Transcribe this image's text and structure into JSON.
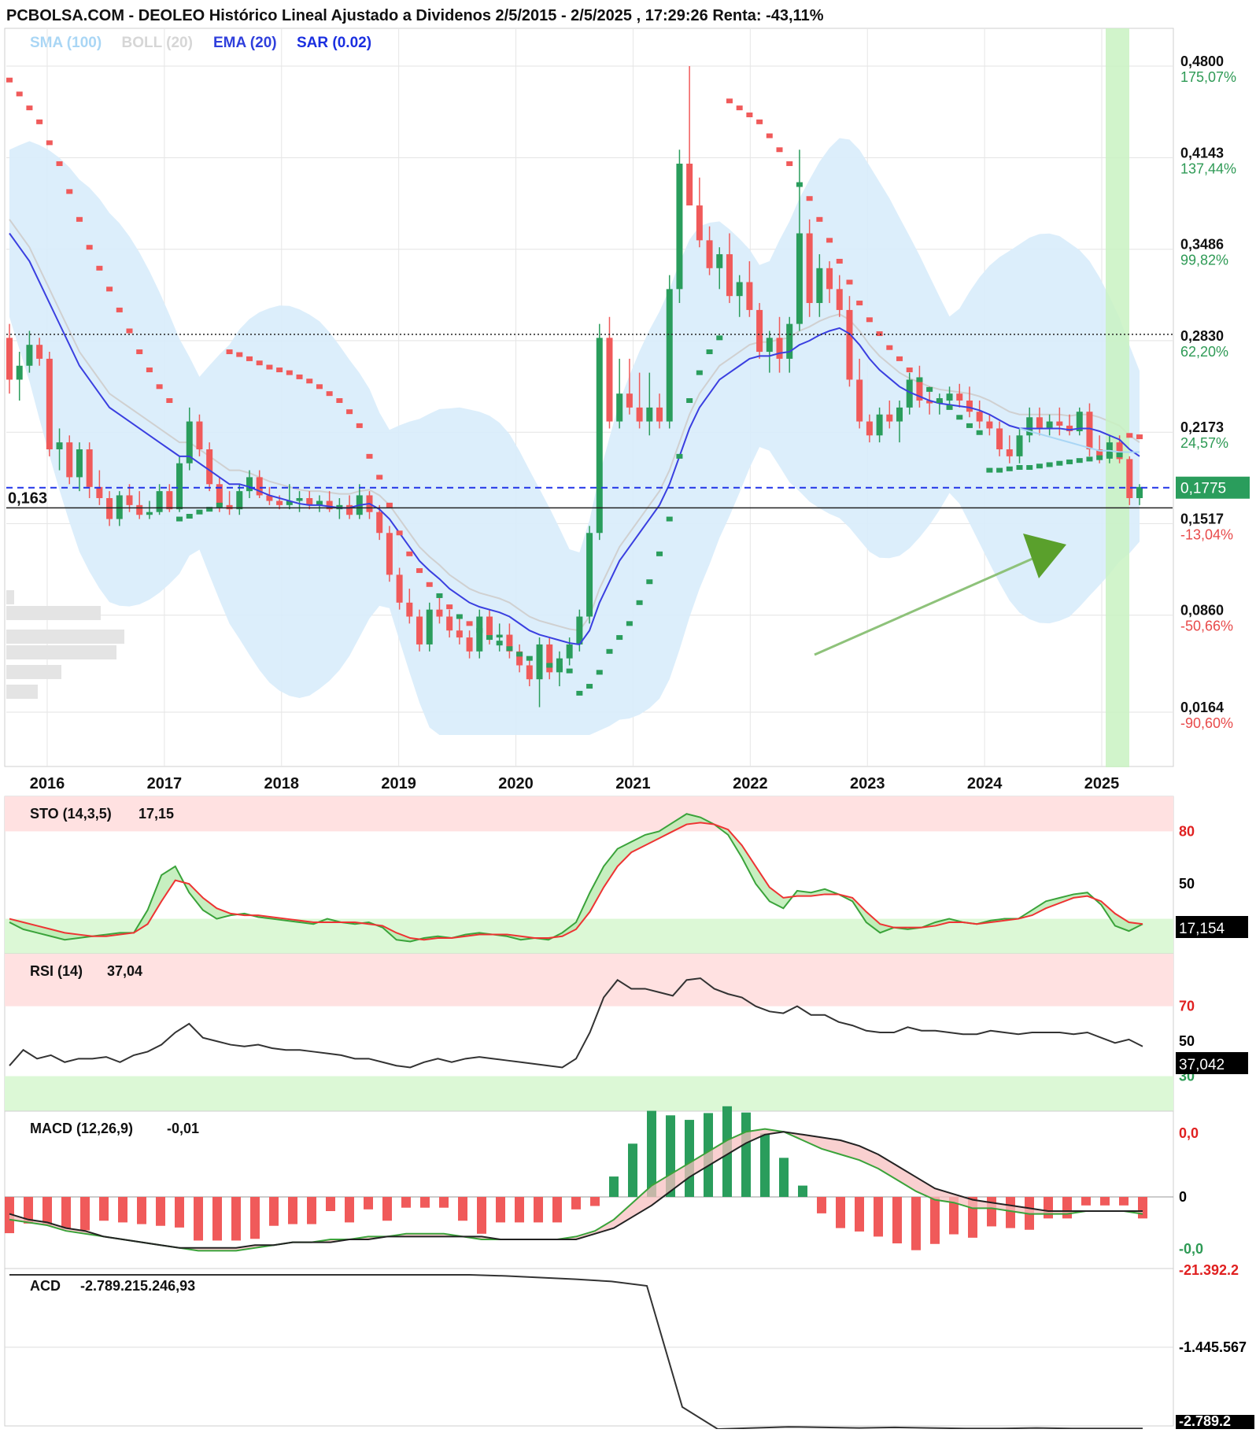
{
  "header": {
    "title": "PCBOLSA.COM - DEOLEO Histórico Lineal Ajustado a Dividenos 2/5/2015 - 2/5/2025 , 17:29:26 Renta: -43,11%"
  },
  "legend": [
    {
      "label": "SMA (100)",
      "color": "#a9d6f5"
    },
    {
      "label": "BOLL (20)",
      "color": "#d6d6d6"
    },
    {
      "label": "EMA (20)",
      "color": "#2f3fdc"
    },
    {
      "label": "SAR (0.02)",
      "color": "#1a2fe0"
    }
  ],
  "price_axis": {
    "ticks": [
      {
        "value": 0.48,
        "label": "0,4800",
        "pct": "175,07%",
        "pct_color": "#2e9a55"
      },
      {
        "value": 0.4143,
        "label": "0,4143",
        "pct": "137,44%",
        "pct_color": "#2e9a55"
      },
      {
        "value": 0.3486,
        "label": "0,3486",
        "pct": "99,82%",
        "pct_color": "#2e9a55"
      },
      {
        "value": 0.283,
        "label": "0,2830",
        "pct": "62,20%",
        "pct_color": "#2e9a55"
      },
      {
        "value": 0.2173,
        "label": "0,2173",
        "pct": "24,57%",
        "pct_color": "#2e9a55"
      },
      {
        "value": 0.1517,
        "label": "0,1517",
        "pct": "-13,04%",
        "pct_color": "#e84a4a"
      },
      {
        "value": 0.086,
        "label": "0,0860",
        "pct": "-50,66%",
        "pct_color": "#e84a4a"
      },
      {
        "value": 0.0164,
        "label": "0,0164",
        "pct": "-90,60%",
        "pct_color": "#e84a4a"
      }
    ],
    "current_price_label": "0,1775",
    "current_price": 0.1775,
    "reference_price_label": "0,163",
    "reference_price": 0.163,
    "dotted_line_price": 0.2875
  },
  "x_axis": {
    "years": [
      "2016",
      "2017",
      "2018",
      "2019",
      "2020",
      "2021",
      "2022",
      "2023",
      "2024",
      "2025"
    ]
  },
  "colors": {
    "up": "#2a9d5c",
    "down": "#f05a5a",
    "boll_fill": "#d8ecfb",
    "ema": "#3a3fe0",
    "sma": "#a9d6f5",
    "boll_mid": "#d0d0d0",
    "highlight": "#c9f2c2",
    "arrow": "#5aa02c"
  },
  "panels": {
    "sto": {
      "label": "STO (14,3,5)",
      "value": "17,15",
      "box": "17,154",
      "ticks": [
        {
          "v": 80,
          "t": "80",
          "c": "#e02020"
        },
        {
          "v": 50,
          "t": "50",
          "c": "#000000"
        }
      ]
    },
    "rsi": {
      "label": "RSI (14)",
      "value": "37,04",
      "box": "37,042",
      "ticks": [
        {
          "v": 70,
          "t": "70",
          "c": "#e02020"
        },
        {
          "v": 50,
          "t": "50",
          "c": "#000000"
        },
        {
          "v": 30,
          "t": "30",
          "c": "#2e9a55"
        }
      ]
    },
    "macd": {
      "label": "MACD (12,26,9)",
      "value": "-0,01",
      "ticks": [
        {
          "t": "0,0",
          "c": "#e02020"
        },
        {
          "t": "0",
          "c": "#000000"
        },
        {
          "t": "-0,0",
          "c": "#2e9a55"
        }
      ]
    },
    "acd": {
      "label": "ACD",
      "value": "-2.789.215.246,93",
      "ticks": [
        {
          "t": "-21.392.2",
          "c": "#e02020"
        },
        {
          "t": "-1.445.567",
          "c": "#000000"
        },
        {
          "t": "-2.789.2",
          "c": "#ffffff"
        }
      ]
    }
  },
  "chart_data": {
    "type": "candlestick",
    "title": "PCBOLSA.COM - DEOLEO Histórico Lineal Ajustado a Dividenos 2/5/2015 - 2/5/2025 , 17:29:26 Renta: -43,11%",
    "ylim": [
      0.0,
      0.51
    ],
    "ohlc_monthly": [
      [
        0.285,
        0.295,
        0.245,
        0.255
      ],
      [
        0.255,
        0.275,
        0.24,
        0.265
      ],
      [
        0.265,
        0.29,
        0.26,
        0.28
      ],
      [
        0.28,
        0.285,
        0.265,
        0.27
      ],
      [
        0.27,
        0.275,
        0.2,
        0.205
      ],
      [
        0.205,
        0.22,
        0.19,
        0.21
      ],
      [
        0.21,
        0.215,
        0.18,
        0.185
      ],
      [
        0.185,
        0.21,
        0.175,
        0.205
      ],
      [
        0.205,
        0.21,
        0.17,
        0.178
      ],
      [
        0.178,
        0.19,
        0.165,
        0.17
      ],
      [
        0.17,
        0.175,
        0.15,
        0.155
      ],
      [
        0.155,
        0.175,
        0.15,
        0.172
      ],
      [
        0.172,
        0.18,
        0.16,
        0.165
      ],
      [
        0.165,
        0.175,
        0.155,
        0.158
      ],
      [
        0.158,
        0.168,
        0.155,
        0.16
      ],
      [
        0.16,
        0.18,
        0.158,
        0.175
      ],
      [
        0.175,
        0.18,
        0.16,
        0.162
      ],
      [
        0.162,
        0.2,
        0.16,
        0.195
      ],
      [
        0.195,
        0.235,
        0.19,
        0.225
      ],
      [
        0.225,
        0.23,
        0.2,
        0.205
      ],
      [
        0.205,
        0.21,
        0.175,
        0.18
      ],
      [
        0.18,
        0.185,
        0.16,
        0.165
      ],
      [
        0.165,
        0.175,
        0.158,
        0.162
      ],
      [
        0.162,
        0.18,
        0.158,
        0.175
      ],
      [
        0.175,
        0.19,
        0.17,
        0.185
      ],
      [
        0.185,
        0.19,
        0.17,
        0.172
      ],
      [
        0.172,
        0.178,
        0.165,
        0.168
      ],
      [
        0.168,
        0.172,
        0.162,
        0.165
      ],
      [
        0.165,
        0.18,
        0.162,
        0.168
      ],
      [
        0.168,
        0.175,
        0.16,
        0.17
      ],
      [
        0.17,
        0.175,
        0.162,
        0.165
      ],
      [
        0.165,
        0.172,
        0.16,
        0.168
      ],
      [
        0.168,
        0.175,
        0.16,
        0.162
      ],
      [
        0.162,
        0.17,
        0.155,
        0.165
      ],
      [
        0.165,
        0.172,
        0.155,
        0.158
      ],
      [
        0.158,
        0.18,
        0.155,
        0.172
      ],
      [
        0.172,
        0.175,
        0.155,
        0.16
      ],
      [
        0.16,
        0.165,
        0.14,
        0.145
      ],
      [
        0.145,
        0.15,
        0.11,
        0.115
      ],
      [
        0.115,
        0.12,
        0.09,
        0.095
      ],
      [
        0.095,
        0.105,
        0.08,
        0.085
      ],
      [
        0.085,
        0.09,
        0.06,
        0.065
      ],
      [
        0.065,
        0.095,
        0.06,
        0.09
      ],
      [
        0.09,
        0.1,
        0.08,
        0.085
      ],
      [
        0.085,
        0.09,
        0.07,
        0.075
      ],
      [
        0.075,
        0.085,
        0.065,
        0.07
      ],
      [
        0.07,
        0.075,
        0.055,
        0.06
      ],
      [
        0.06,
        0.09,
        0.055,
        0.085
      ],
      [
        0.085,
        0.09,
        0.065,
        0.07
      ],
      [
        0.07,
        0.08,
        0.06,
        0.072
      ],
      [
        0.072,
        0.08,
        0.055,
        0.06
      ],
      [
        0.06,
        0.065,
        0.045,
        0.05
      ],
      [
        0.05,
        0.055,
        0.035,
        0.04
      ],
      [
        0.04,
        0.07,
        0.02,
        0.065
      ],
      [
        0.065,
        0.07,
        0.04,
        0.045
      ],
      [
        0.045,
        0.06,
        0.035,
        0.055
      ],
      [
        0.055,
        0.07,
        0.05,
        0.065
      ],
      [
        0.065,
        0.09,
        0.06,
        0.085
      ],
      [
        0.085,
        0.15,
        0.08,
        0.145
      ],
      [
        0.145,
        0.295,
        0.14,
        0.285
      ],
      [
        0.285,
        0.3,
        0.22,
        0.225
      ],
      [
        0.225,
        0.27,
        0.22,
        0.245
      ],
      [
        0.245,
        0.27,
        0.23,
        0.235
      ],
      [
        0.235,
        0.26,
        0.22,
        0.225
      ],
      [
        0.225,
        0.26,
        0.215,
        0.235
      ],
      [
        0.235,
        0.245,
        0.22,
        0.225
      ],
      [
        0.225,
        0.33,
        0.22,
        0.32
      ],
      [
        0.32,
        0.42,
        0.31,
        0.41
      ],
      [
        0.41,
        0.48,
        0.4,
        0.38
      ],
      [
        0.38,
        0.4,
        0.35,
        0.355
      ],
      [
        0.355,
        0.365,
        0.33,
        0.335
      ],
      [
        0.335,
        0.35,
        0.32,
        0.345
      ],
      [
        0.345,
        0.36,
        0.31,
        0.315
      ],
      [
        0.315,
        0.33,
        0.3,
        0.325
      ],
      [
        0.325,
        0.34,
        0.3,
        0.305
      ],
      [
        0.305,
        0.31,
        0.27,
        0.275
      ],
      [
        0.275,
        0.29,
        0.26,
        0.285
      ],
      [
        0.285,
        0.3,
        0.26,
        0.27
      ],
      [
        0.27,
        0.3,
        0.26,
        0.295
      ],
      [
        0.295,
        0.42,
        0.29,
        0.36
      ],
      [
        0.36,
        0.37,
        0.3,
        0.31
      ],
      [
        0.31,
        0.345,
        0.3,
        0.335
      ],
      [
        0.335,
        0.34,
        0.31,
        0.32
      ],
      [
        0.32,
        0.33,
        0.3,
        0.305
      ],
      [
        0.305,
        0.315,
        0.25,
        0.255
      ],
      [
        0.255,
        0.27,
        0.22,
        0.225
      ],
      [
        0.225,
        0.23,
        0.21,
        0.215
      ],
      [
        0.215,
        0.235,
        0.21,
        0.23
      ],
      [
        0.23,
        0.24,
        0.22,
        0.225
      ],
      [
        0.225,
        0.24,
        0.21,
        0.235
      ],
      [
        0.235,
        0.26,
        0.23,
        0.255
      ],
      [
        0.255,
        0.265,
        0.235,
        0.24
      ],
      [
        0.24,
        0.25,
        0.23,
        0.238
      ],
      [
        0.238,
        0.245,
        0.23,
        0.24
      ],
      [
        0.24,
        0.25,
        0.235,
        0.245
      ],
      [
        0.245,
        0.252,
        0.235,
        0.24
      ],
      [
        0.24,
        0.25,
        0.228,
        0.232
      ],
      [
        0.232,
        0.24,
        0.22,
        0.225
      ],
      [
        0.225,
        0.23,
        0.215,
        0.22
      ],
      [
        0.22,
        0.225,
        0.2,
        0.205
      ],
      [
        0.205,
        0.215,
        0.195,
        0.2
      ],
      [
        0.2,
        0.22,
        0.195,
        0.215
      ],
      [
        0.215,
        0.235,
        0.21,
        0.228
      ],
      [
        0.228,
        0.235,
        0.215,
        0.22
      ],
      [
        0.22,
        0.23,
        0.215,
        0.225
      ],
      [
        0.225,
        0.235,
        0.215,
        0.222
      ],
      [
        0.222,
        0.23,
        0.215,
        0.218
      ],
      [
        0.218,
        0.235,
        0.215,
        0.232
      ],
      [
        0.232,
        0.238,
        0.2,
        0.205
      ],
      [
        0.205,
        0.215,
        0.195,
        0.2
      ],
      [
        0.2,
        0.215,
        0.195,
        0.21
      ],
      [
        0.21,
        0.215,
        0.195,
        0.198
      ],
      [
        0.198,
        0.2,
        0.165,
        0.17
      ],
      [
        0.17,
        0.18,
        0.165,
        0.178
      ]
    ],
    "ema_20": [
      0.36,
      0.35,
      0.34,
      0.325,
      0.31,
      0.295,
      0.28,
      0.265,
      0.255,
      0.245,
      0.235,
      0.23,
      0.225,
      0.22,
      0.215,
      0.21,
      0.205,
      0.2,
      0.2,
      0.195,
      0.19,
      0.185,
      0.18,
      0.18,
      0.178,
      0.175,
      0.172,
      0.17,
      0.168,
      0.166,
      0.165,
      0.165,
      0.164,
      0.163,
      0.163,
      0.165,
      0.166,
      0.162,
      0.155,
      0.145,
      0.135,
      0.125,
      0.118,
      0.112,
      0.105,
      0.1,
      0.095,
      0.092,
      0.09,
      0.088,
      0.085,
      0.08,
      0.075,
      0.072,
      0.07,
      0.068,
      0.066,
      0.065,
      0.075,
      0.095,
      0.11,
      0.125,
      0.135,
      0.145,
      0.155,
      0.165,
      0.18,
      0.2,
      0.22,
      0.235,
      0.245,
      0.255,
      0.26,
      0.265,
      0.27,
      0.272,
      0.272,
      0.274,
      0.275,
      0.28,
      0.283,
      0.287,
      0.29,
      0.292,
      0.288,
      0.28,
      0.27,
      0.262,
      0.256,
      0.25,
      0.246,
      0.243,
      0.24,
      0.238,
      0.237,
      0.236,
      0.235,
      0.233,
      0.23,
      0.226,
      0.222,
      0.22,
      0.22,
      0.22,
      0.22,
      0.22,
      0.219,
      0.22,
      0.22,
      0.218,
      0.215,
      0.212,
      0.205,
      0.2
    ],
    "sma_100": [
      0.22,
      0.218,
      0.216,
      0.214,
      0.212,
      0.21,
      0.208,
      0.206,
      0.204,
      0.204,
      0.203,
      0.203,
      0.203
    ],
    "sar": [
      0.47,
      0.46,
      0.45,
      0.44,
      0.425,
      0.41,
      0.39,
      0.37,
      0.35,
      0.335,
      0.32,
      0.305,
      0.29,
      0.275,
      0.262,
      0.25,
      0.24,
      0.155,
      0.157,
      0.16,
      0.162,
      0.165,
      0.275,
      0.273,
      0.27,
      0.267,
      0.264,
      0.262,
      0.26,
      0.257,
      0.254,
      0.25,
      0.245,
      0.24,
      0.232,
      0.222,
      0.2,
      0.185,
      0.165,
      0.145,
      0.13,
      0.118,
      0.108,
      0.1,
      0.092,
      0.085,
      0.08,
      0.075,
      0.07,
      0.066,
      0.062,
      0.058,
      0.055,
      0.052,
      0.05,
      0.048,
      0.046,
      0.03,
      0.035,
      0.045,
      0.06,
      0.07,
      0.08,
      0.095,
      0.11,
      0.13,
      0.155,
      0.2,
      0.24,
      0.26,
      0.275,
      0.285,
      0.455,
      0.45,
      0.445,
      0.44,
      0.43,
      0.42,
      0.41,
      0.395,
      0.385,
      0.37,
      0.355,
      0.34,
      0.325,
      0.31,
      0.298,
      0.288,
      0.278,
      0.27,
      0.262,
      0.255,
      0.248,
      0.24,
      0.235,
      0.228,
      0.222,
      0.217,
      0.19,
      0.19,
      0.191,
      0.192,
      0.192,
      0.193,
      0.194,
      0.195,
      0.196,
      0.197,
      0.198,
      0.199,
      0.2,
      0.201,
      0.215,
      0.214,
      0.213,
      0.212
    ],
    "sto_k": [
      28,
      24,
      22,
      20,
      18,
      19,
      20,
      21,
      22,
      22,
      35,
      55,
      60,
      45,
      35,
      30,
      32,
      33,
      31,
      30,
      29,
      28,
      27,
      30,
      28,
      27,
      28,
      25,
      18,
      17,
      19,
      20,
      19,
      21,
      22,
      21,
      20,
      18,
      19,
      18,
      22,
      28,
      45,
      60,
      70,
      74,
      78,
      80,
      85,
      90,
      88,
      84,
      78,
      65,
      50,
      40,
      36,
      46,
      45,
      47,
      44,
      40,
      28,
      22,
      25,
      24,
      25,
      28,
      30,
      28,
      27,
      29,
      30,
      30,
      35,
      40,
      42,
      44,
      45,
      38,
      26,
      23,
      27
    ],
    "sto_d": [
      30,
      28,
      26,
      24,
      22,
      21,
      20,
      20,
      21,
      22,
      27,
      40,
      52,
      50,
      42,
      36,
      33,
      32,
      32,
      31,
      30,
      29,
      28,
      28,
      28,
      28,
      27,
      26,
      22,
      19,
      18,
      19,
      19,
      20,
      21,
      21,
      21,
      20,
      19,
      19,
      20,
      24,
      34,
      48,
      60,
      68,
      72,
      76,
      80,
      84,
      85,
      84,
      81,
      72,
      60,
      48,
      42,
      43,
      43,
      44,
      44,
      42,
      34,
      27,
      25,
      25,
      25,
      26,
      28,
      28,
      27,
      28,
      29,
      30,
      32,
      36,
      39,
      42,
      43,
      40,
      33,
      28,
      27
    ],
    "rsi": [
      36,
      45,
      40,
      42,
      38,
      40,
      40,
      41,
      38,
      42,
      44,
      48,
      55,
      60,
      52,
      50,
      48,
      47,
      48,
      46,
      45,
      45,
      44,
      43,
      42,
      40,
      40,
      38,
      36,
      35,
      38,
      40,
      38,
      40,
      41,
      40,
      39,
      38,
      37,
      36,
      35,
      40,
      55,
      75,
      85,
      80,
      80,
      78,
      76,
      85,
      86,
      80,
      77,
      75,
      70,
      67,
      66,
      70,
      65,
      65,
      61,
      59,
      56,
      55,
      55,
      58,
      56,
      56,
      55,
      54,
      54,
      56,
      55,
      54,
      55,
      55,
      55,
      54,
      55,
      52,
      49,
      51,
      47
    ],
    "macd_line": [
      -0.008,
      -0.009,
      -0.01,
      -0.012,
      -0.013,
      -0.014,
      -0.015,
      -0.016,
      -0.017,
      -0.018,
      -0.019,
      -0.019,
      -0.019,
      -0.018,
      -0.017,
      -0.016,
      -0.016,
      -0.015,
      -0.015,
      -0.014,
      -0.014,
      -0.013,
      -0.013,
      -0.013,
      -0.014,
      -0.015,
      -0.015,
      -0.015,
      -0.015,
      -0.015,
      -0.014,
      -0.012,
      -0.008,
      -0.002,
      0.004,
      0.008,
      0.012,
      0.016,
      0.02,
      0.023,
      0.024,
      0.023,
      0.02,
      0.017,
      0.015,
      0.013,
      0.01,
      0.006,
      0.002,
      -0.001,
      -0.002,
      -0.004,
      -0.004,
      -0.005,
      -0.006,
      -0.006,
      -0.006,
      -0.005,
      -0.005,
      -0.005,
      -0.006
    ],
    "macd_signal": [
      -0.006,
      -0.008,
      -0.009,
      -0.011,
      -0.012,
      -0.014,
      -0.015,
      -0.016,
      -0.017,
      -0.018,
      -0.018,
      -0.018,
      -0.018,
      -0.017,
      -0.017,
      -0.016,
      -0.016,
      -0.016,
      -0.015,
      -0.015,
      -0.014,
      -0.014,
      -0.014,
      -0.014,
      -0.014,
      -0.014,
      -0.015,
      -0.015,
      -0.015,
      -0.015,
      -0.015,
      -0.013,
      -0.011,
      -0.007,
      -0.003,
      0.002,
      0.007,
      0.011,
      0.015,
      0.019,
      0.022,
      0.023,
      0.022,
      0.021,
      0.02,
      0.018,
      0.015,
      0.011,
      0.007,
      0.003,
      0.001,
      -0.001,
      -0.002,
      -0.003,
      -0.004,
      -0.005,
      -0.005,
      -0.005,
      -0.005,
      -0.005,
      -0.005
    ],
    "acd": [
      0,
      0,
      0,
      0,
      0,
      0,
      0,
      0,
      0,
      0,
      0,
      0,
      0,
      0,
      -0.02,
      -0.05,
      -0.08,
      -0.12,
      -0.2,
      -2.4,
      -2.8,
      -2.78,
      -2.76,
      -2.77,
      -2.78,
      -2.77,
      -2.78,
      -2.79,
      -2.79,
      -2.78,
      -2.79,
      -2.79,
      -2.79
    ]
  }
}
